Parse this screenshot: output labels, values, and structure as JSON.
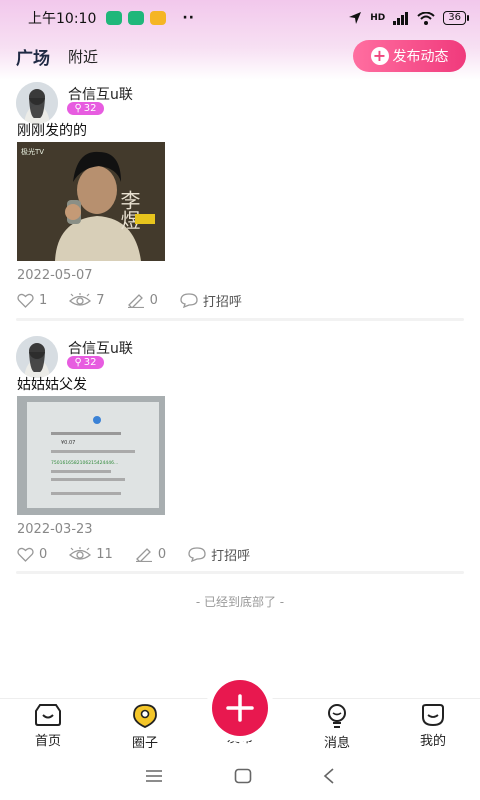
{
  "status_bar": {
    "time": "上午10:10",
    "network": "HD",
    "battery": "36"
  },
  "nav": {
    "tab_square": "广场",
    "tab_nearby": "附近",
    "post_button": "发布动态"
  },
  "posts": [
    {
      "username": "合信互u联",
      "badge": "32",
      "text": "刚刚发的的",
      "date": "2022-05-07",
      "likes": "1",
      "views": "7",
      "comments": "0",
      "greet": "打招呼"
    },
    {
      "username": "合信互u联",
      "badge": "32",
      "text": "姑姑姑父发",
      "date": "2022-03-23",
      "likes": "0",
      "views": "11",
      "comments": "0",
      "greet": "打招呼"
    }
  ],
  "photo1_text": {
    "watermark": "极光TV",
    "title": "李煜"
  },
  "photo2_text": {
    "amount": "¥0.07",
    "number": "7501616582106215424446..."
  },
  "end_note": "- 已经到底部了 -",
  "tabbar": {
    "home": "首页",
    "circle": "圈子",
    "publish": "发布",
    "messages": "消息",
    "mine": "我的"
  },
  "colors": {
    "accent": "#f03a7c",
    "badge": "#e75ce0",
    "publish": "#e8184f"
  }
}
